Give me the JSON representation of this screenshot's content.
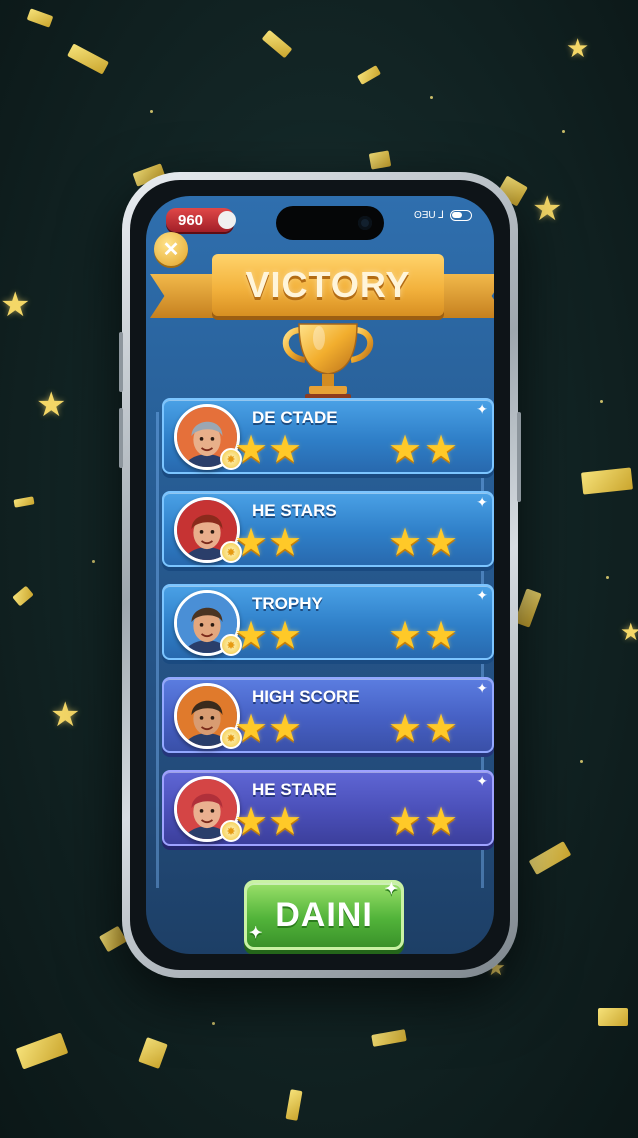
{
  "status_bar": {
    "score": "960",
    "right_text": "ʘƎU ⅃"
  },
  "header": {
    "close_symbol": "✕",
    "title": "VICTORY"
  },
  "players": [
    {
      "name": "DE CTADE",
      "stars": 4,
      "hair": "#9aa7b3",
      "skin": "#e8b08a",
      "bg": "#e5703a"
    },
    {
      "name": "HE STARS",
      "stars": 4,
      "hair": "#8a2a1c",
      "skin": "#e9ae8c",
      "bg": "#c63333"
    },
    {
      "name": "TROPHY",
      "stars": 4,
      "hair": "#4a3422",
      "skin": "#e3a77e",
      "bg": "#4a8fd6"
    },
    {
      "name": "HIGH SCORE",
      "stars": 4,
      "hair": "#3a2a1c",
      "skin": "#d89c72",
      "bg": "#e07a2c"
    },
    {
      "name": "HE STARE",
      "stars": 4,
      "hair": "#b0303a",
      "skin": "#eab090",
      "bg": "#d44545"
    }
  ],
  "action_button": {
    "label": "DAINI"
  },
  "colors": {
    "accent_gold": "#f3b33e",
    "button_green": "#52b43a",
    "card_blue": "#2f7fc8"
  }
}
